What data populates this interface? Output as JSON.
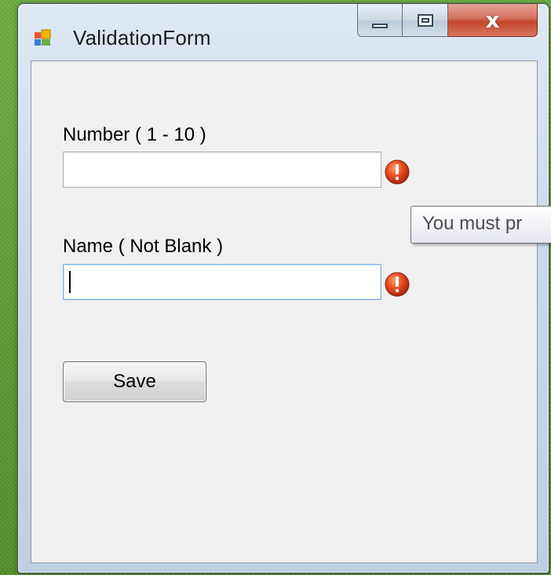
{
  "window": {
    "title": "ValidationForm",
    "icon": "winforms-app-icon",
    "buttons": {
      "minimize": "minimize-icon",
      "maximize": "maximize-icon",
      "close": "close-icon"
    }
  },
  "form": {
    "number_label": "Number ( 1 - 10 )",
    "number_value": "",
    "name_label": "Name ( Not Blank )",
    "name_value": "",
    "save_label": "Save",
    "error_icon": "error-exclamation-icon"
  },
  "tooltip": {
    "text": "You must pr"
  },
  "colors": {
    "desktop": "#5c9e33",
    "client_bg": "#f0f0f0",
    "error_red": "#d8401c",
    "close_red": "#c3452c"
  }
}
